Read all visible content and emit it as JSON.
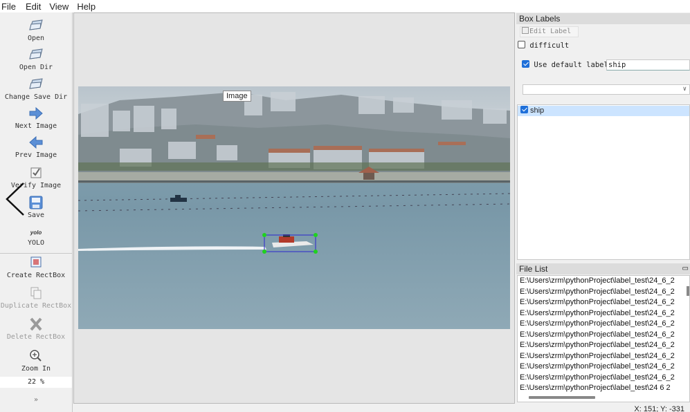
{
  "menu": [
    "File",
    "Edit",
    "View",
    "Help"
  ],
  "toolbar": {
    "open": "Open",
    "open_dir": "Open Dir",
    "change_save_dir": "Change Save Dir",
    "next_image": "Next Image",
    "prev_image": "Prev Image",
    "verify_image": "Verify Image",
    "save": "Save",
    "format_icon_text": "yolo",
    "format": "YOLO",
    "create_rectbox": "Create RectBox",
    "duplicate_rectbox": "Duplicate RectBox",
    "delete_rectbox": "Delete RectBox",
    "zoom_in": "Zoom In",
    "zoom_value": "22 %",
    "more": "»"
  },
  "canvas": {
    "tooltip": "Image",
    "box_label": "ship"
  },
  "box_labels": {
    "title": "Box Labels",
    "edit_label": "Edit Label",
    "difficult": "difficult",
    "difficult_checked": false,
    "use_default_label": "Use default label",
    "use_default_checked": true,
    "default_label_value": "ship",
    "combo_value": "",
    "labels": [
      {
        "name": "ship",
        "checked": true
      }
    ]
  },
  "file_list": {
    "title": "File List",
    "files": [
      "E:\\Users\\zrm\\pythonProject\\label_test\\24_6_2",
      "E:\\Users\\zrm\\pythonProject\\label_test\\24_6_2",
      "E:\\Users\\zrm\\pythonProject\\label_test\\24_6_2",
      "E:\\Users\\zrm\\pythonProject\\label_test\\24_6_2",
      "E:\\Users\\zrm\\pythonProject\\label_test\\24_6_2",
      "E:\\Users\\zrm\\pythonProject\\label_test\\24_6_2",
      "E:\\Users\\zrm\\pythonProject\\label_test\\24_6_2",
      "E:\\Users\\zrm\\pythonProject\\label_test\\24_6_2",
      "E:\\Users\\zrm\\pythonProject\\label_test\\24_6_2",
      "E:\\Users\\zrm\\pythonProject\\label_test\\24_6_2",
      "E:\\Users\\zrm\\pythonProject\\label_test\\24 6 2"
    ]
  },
  "status": {
    "coords": "X: 151; Y: -331"
  },
  "colors": {
    "accent": "#1e6fd9",
    "selection": "#cce4ff",
    "bbox": "#3a3ac8",
    "handle": "#1fd21f"
  }
}
